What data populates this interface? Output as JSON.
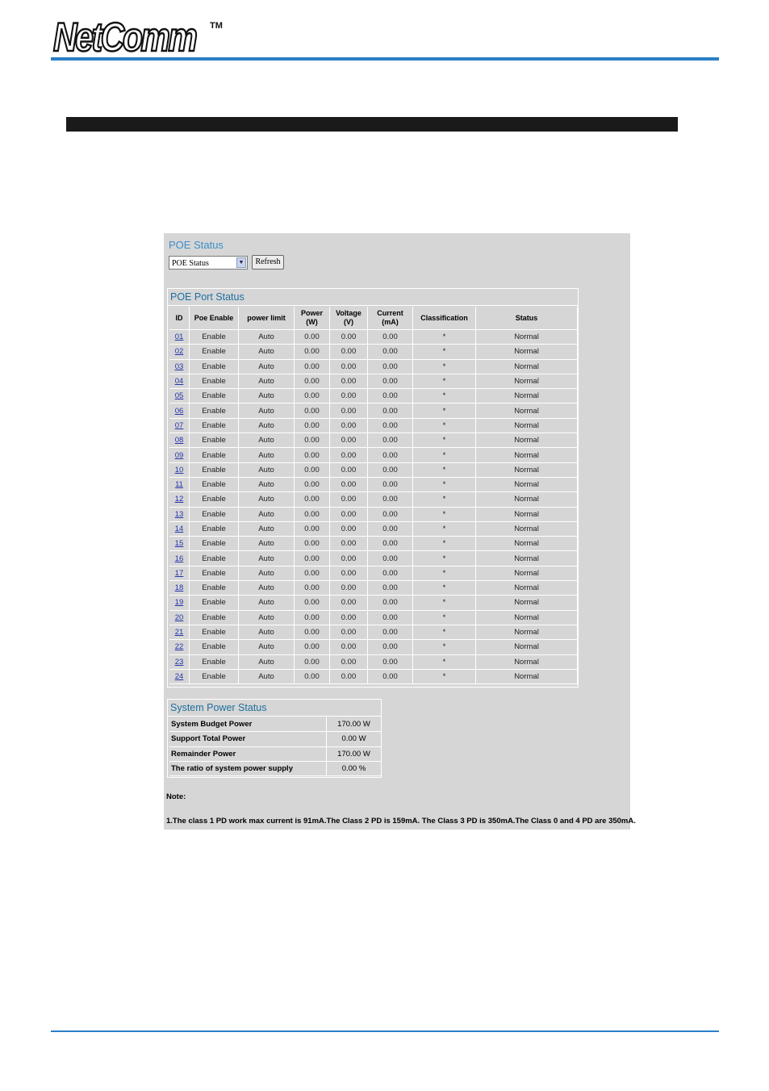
{
  "brand": {
    "name": "NetComm",
    "tm": "TM"
  },
  "poe_status": {
    "title": "POE Status",
    "select_value": "POE Status",
    "refresh_label": "Refresh"
  },
  "port_status": {
    "title": "POE Port Status",
    "columns": [
      "ID",
      "Poe Enable",
      "power limit",
      "Power (W)",
      "Voltage (V)",
      "Current (mA)",
      "Classification",
      "Status"
    ],
    "rows": [
      [
        "01",
        "Enable",
        "Auto",
        "0.00",
        "0.00",
        "0.00",
        "*",
        "Normal"
      ],
      [
        "02",
        "Enable",
        "Auto",
        "0.00",
        "0.00",
        "0.00",
        "*",
        "Normal"
      ],
      [
        "03",
        "Enable",
        "Auto",
        "0.00",
        "0.00",
        "0.00",
        "*",
        "Normal"
      ],
      [
        "04",
        "Enable",
        "Auto",
        "0.00",
        "0.00",
        "0.00",
        "*",
        "Normal"
      ],
      [
        "05",
        "Enable",
        "Auto",
        "0.00",
        "0.00",
        "0.00",
        "*",
        "Normal"
      ],
      [
        "06",
        "Enable",
        "Auto",
        "0.00",
        "0.00",
        "0.00",
        "*",
        "Normal"
      ],
      [
        "07",
        "Enable",
        "Auto",
        "0.00",
        "0.00",
        "0.00",
        "*",
        "Normal"
      ],
      [
        "08",
        "Enable",
        "Auto",
        "0.00",
        "0.00",
        "0.00",
        "*",
        "Normal"
      ],
      [
        "09",
        "Enable",
        "Auto",
        "0.00",
        "0.00",
        "0.00",
        "*",
        "Normal"
      ],
      [
        "10",
        "Enable",
        "Auto",
        "0.00",
        "0.00",
        "0.00",
        "*",
        "Normal"
      ],
      [
        "11",
        "Enable",
        "Auto",
        "0.00",
        "0.00",
        "0.00",
        "*",
        "Normal"
      ],
      [
        "12",
        "Enable",
        "Auto",
        "0.00",
        "0.00",
        "0.00",
        "*",
        "Normal"
      ],
      [
        "13",
        "Enable",
        "Auto",
        "0.00",
        "0.00",
        "0.00",
        "*",
        "Normal"
      ],
      [
        "14",
        "Enable",
        "Auto",
        "0.00",
        "0.00",
        "0.00",
        "*",
        "Normal"
      ],
      [
        "15",
        "Enable",
        "Auto",
        "0.00",
        "0.00",
        "0.00",
        "*",
        "Normal"
      ],
      [
        "16",
        "Enable",
        "Auto",
        "0.00",
        "0.00",
        "0.00",
        "*",
        "Normal"
      ],
      [
        "17",
        "Enable",
        "Auto",
        "0.00",
        "0.00",
        "0.00",
        "*",
        "Normal"
      ],
      [
        "18",
        "Enable",
        "Auto",
        "0.00",
        "0.00",
        "0.00",
        "*",
        "Normal"
      ],
      [
        "19",
        "Enable",
        "Auto",
        "0.00",
        "0.00",
        "0.00",
        "*",
        "Normal"
      ],
      [
        "20",
        "Enable",
        "Auto",
        "0.00",
        "0.00",
        "0.00",
        "*",
        "Normal"
      ],
      [
        "21",
        "Enable",
        "Auto",
        "0.00",
        "0.00",
        "0.00",
        "*",
        "Normal"
      ],
      [
        "22",
        "Enable",
        "Auto",
        "0.00",
        "0.00",
        "0.00",
        "*",
        "Normal"
      ],
      [
        "23",
        "Enable",
        "Auto",
        "0.00",
        "0.00",
        "0.00",
        "*",
        "Normal"
      ],
      [
        "24",
        "Enable",
        "Auto",
        "0.00",
        "0.00",
        "0.00",
        "*",
        "Normal"
      ]
    ]
  },
  "system_power": {
    "title": "System Power Status",
    "rows": [
      {
        "label": "System Budget Power",
        "value": "170.00 W"
      },
      {
        "label": "Support Total Power",
        "value": "0.00 W"
      },
      {
        "label": "Remainder Power",
        "value": "170.00 W"
      },
      {
        "label": "The ratio of system power supply",
        "value": "0.00 %"
      }
    ]
  },
  "note": {
    "heading": "Note:",
    "text": "1.The class 1 PD work max current is 91mA.The Class 2 PD is 159mA. The Class 3 PD is 350mA.The Class 0 and 4 PD are 350mA."
  },
  "colors": {
    "accent": "#2a7fc7",
    "panel_bg": "#d6d6d6",
    "title_blue": "#3b8fc9"
  }
}
